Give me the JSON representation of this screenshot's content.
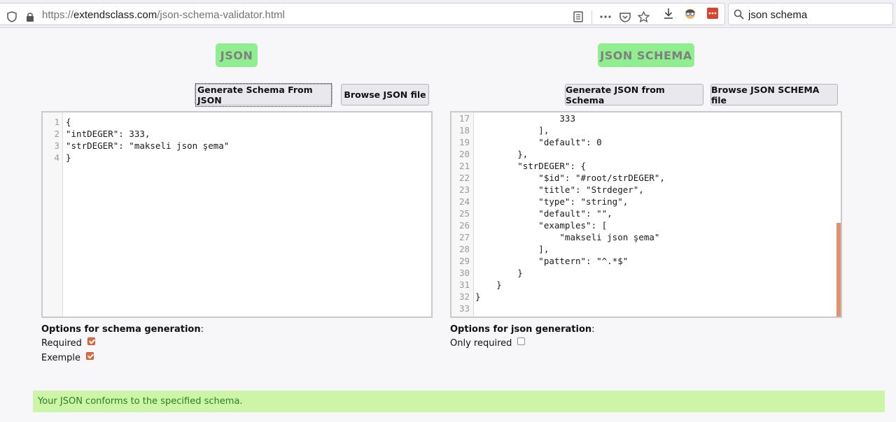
{
  "browser": {
    "url_prefix": "https://",
    "url_host": "extendsclass.com",
    "url_path": "/json-schema-validator.html",
    "search_value": "json schema"
  },
  "json_panel": {
    "heading": "JSON",
    "generate_button": "Generate Schema From JSON",
    "browse_button": "Browse JSON file",
    "lines": [
      {
        "n": "1",
        "text": "{"
      },
      {
        "n": "2",
        "text": "\"intDEGER\": 333,"
      },
      {
        "n": "3",
        "text": "\"strDEGER\": \"makseli json şema\""
      },
      {
        "n": "4",
        "text": "}"
      }
    ],
    "options_title": "Options for schema generation",
    "options_colon": ":",
    "options": [
      {
        "label": "Required",
        "checked": true
      },
      {
        "label": "Exemple",
        "checked": true
      }
    ]
  },
  "schema_panel": {
    "heading": "JSON SCHEMA",
    "generate_button": "Generate JSON from Schema",
    "browse_button": "Browse JSON SCHEMA file",
    "lines": [
      {
        "n": "17",
        "text": "                333"
      },
      {
        "n": "18",
        "text": "            ],"
      },
      {
        "n": "19",
        "text": "            \"default\": 0"
      },
      {
        "n": "20",
        "text": "        },"
      },
      {
        "n": "21",
        "text": "        \"strDEGER\": {"
      },
      {
        "n": "22",
        "text": "            \"$id\": \"#root/strDEGER\","
      },
      {
        "n": "23",
        "text": "            \"title\": \"Strdeger\","
      },
      {
        "n": "24",
        "text": "            \"type\": \"string\","
      },
      {
        "n": "25",
        "text": "            \"default\": \"\","
      },
      {
        "n": "26",
        "text": "            \"examples\": ["
      },
      {
        "n": "27",
        "text": "                \"makseli json şema\""
      },
      {
        "n": "28",
        "text": "            ],"
      },
      {
        "n": "29",
        "text": "            \"pattern\": \"^.*$\""
      },
      {
        "n": "30",
        "text": "        }"
      },
      {
        "n": "31",
        "text": "    }"
      },
      {
        "n": "32",
        "text": "}"
      },
      {
        "n": "33",
        "text": ""
      }
    ],
    "options_title": "Options for json generation",
    "options_colon": ":",
    "options": [
      {
        "label": "Only required",
        "checked": false
      }
    ]
  },
  "status": {
    "message": "Your JSON conforms to the specified schema.",
    "color": "#ccf5a8"
  },
  "colors": {
    "heading_bg": "#90ee90",
    "checkbox_on": "#e26b3f",
    "scroll_accent": "#e3906d"
  }
}
